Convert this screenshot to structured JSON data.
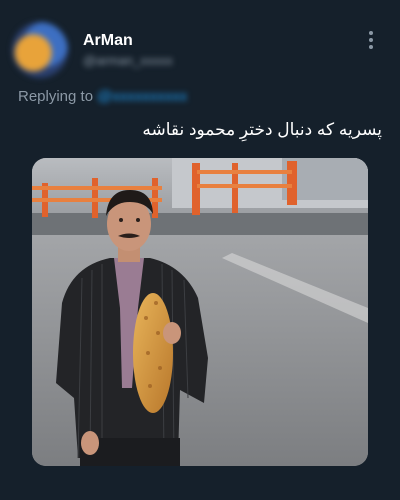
{
  "tweet": {
    "display_name": "ArMan",
    "handle": "@arman_xxxxx",
    "replying_label": "Replying to",
    "replying_handle": "@xxxxxxxxxx",
    "text": "پسریه که دنبال دخترِ محمود نقاشه",
    "media_description": "photo-man-holding-bread"
  },
  "colors": {
    "background": "#15202b",
    "name": "#ffffff",
    "secondary": "#8b98a5",
    "link": "#1d9bf0"
  }
}
